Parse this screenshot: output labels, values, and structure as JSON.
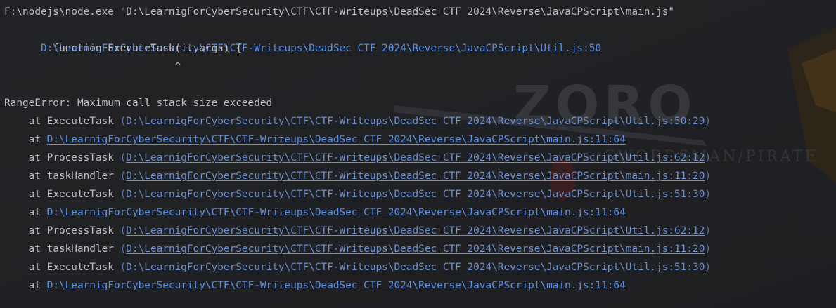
{
  "console": {
    "command": "F:\\nodejs\\node.exe \"D:\\LearnigForCyberSecurity\\CTF\\CTF-Writeups\\DeadSec CTF 2024\\Reverse\\JavaCPScript\\main.js\"",
    "error_location_link": "D:\\LearnigForCyberSecurity\\CTF\\CTF-Writeups\\DeadSec CTF 2024\\Reverse\\JavaCPScript\\Util.js:50",
    "source_line": "        function ExecuteTask(...args) {",
    "caret_line": "                            ^",
    "error_message": "RangeError: Maximum call stack size exceeded",
    "watermark": "ZORO",
    "watermark_sub": "SWORDSMAN/PIRATE",
    "colors": {
      "background": "#1e1f22",
      "text": "#bcbec4",
      "link": "#5a8fe6"
    },
    "stack": [
      {
        "prefix": "    at ",
        "fn": "ExecuteTask ",
        "open": "(",
        "link": "D:\\LearnigForCyberSecurity\\CTF\\CTF-Writeups\\DeadSec CTF 2024\\Reverse\\JavaCPScript\\Util.js:50:29",
        "close": ")"
      },
      {
        "prefix": "    at ",
        "fn": "",
        "open": "",
        "link": "D:\\LearnigForCyberSecurity\\CTF\\CTF-Writeups\\DeadSec CTF 2024\\Reverse\\JavaCPScript\\main.js:11:64",
        "close": ""
      },
      {
        "prefix": "    at ",
        "fn": "ProcessTask ",
        "open": "(",
        "link": "D:\\LearnigForCyberSecurity\\CTF\\CTF-Writeups\\DeadSec CTF 2024\\Reverse\\JavaCPScript\\Util.js:62:12",
        "close": ")"
      },
      {
        "prefix": "    at ",
        "fn": "taskHandler ",
        "open": "(",
        "link": "D:\\LearnigForCyberSecurity\\CTF\\CTF-Writeups\\DeadSec CTF 2024\\Reverse\\JavaCPScript\\main.js:11:20",
        "close": ")"
      },
      {
        "prefix": "    at ",
        "fn": "ExecuteTask ",
        "open": "(",
        "link": "D:\\LearnigForCyberSecurity\\CTF\\CTF-Writeups\\DeadSec CTF 2024\\Reverse\\JavaCPScript\\Util.js:51:30",
        "close": ")"
      },
      {
        "prefix": "    at ",
        "fn": "",
        "open": "",
        "link": "D:\\LearnigForCyberSecurity\\CTF\\CTF-Writeups\\DeadSec CTF 2024\\Reverse\\JavaCPScript\\main.js:11:64",
        "close": ""
      },
      {
        "prefix": "    at ",
        "fn": "ProcessTask ",
        "open": "(",
        "link": "D:\\LearnigForCyberSecurity\\CTF\\CTF-Writeups\\DeadSec CTF 2024\\Reverse\\JavaCPScript\\Util.js:62:12",
        "close": ")"
      },
      {
        "prefix": "    at ",
        "fn": "taskHandler ",
        "open": "(",
        "link": "D:\\LearnigForCyberSecurity\\CTF\\CTF-Writeups\\DeadSec CTF 2024\\Reverse\\JavaCPScript\\main.js:11:20",
        "close": ")"
      },
      {
        "prefix": "    at ",
        "fn": "ExecuteTask ",
        "open": "(",
        "link": "D:\\LearnigForCyberSecurity\\CTF\\CTF-Writeups\\DeadSec CTF 2024\\Reverse\\JavaCPScript\\Util.js:51:30",
        "close": ")"
      },
      {
        "prefix": "    at ",
        "fn": "",
        "open": "",
        "link": "D:\\LearnigForCyberSecurity\\CTF\\CTF-Writeups\\DeadSec CTF 2024\\Reverse\\JavaCPScript\\main.js:11:64",
        "close": ""
      }
    ]
  }
}
